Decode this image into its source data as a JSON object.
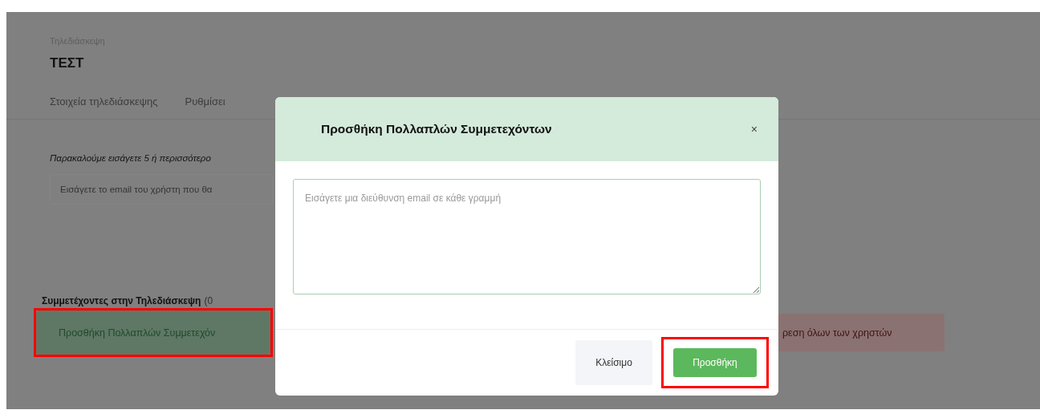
{
  "page": {
    "breadcrumb": "Τηλεδιάσκεψη",
    "title": "ΤΕΣΤ",
    "tabs": [
      "Στοιχεία τηλεδιάσκεψης",
      "Ρυθμίσει"
    ],
    "instruction": "Παρακαλούμε εισάγετε 5 ή περισσότερο",
    "email_field": {
      "placeholder": "Εισάγετε το email του χρήστη που θα"
    },
    "participants_label": "Συμμετέχοντες στην Τηλεδιάσκεψη",
    "participants_count": "(0",
    "add_multiple_button": {
      "label": "Προσθήκη Πολλαπλών Συμμετεχόν",
      "highlighted": true
    },
    "remove_all_button": {
      "label": "ρεση όλων των χρηστών",
      "highlighted": false
    }
  },
  "modal": {
    "title": "Προσθήκη Πολλαπλών Συμμετεχόντων",
    "close": "×",
    "textarea": {
      "placeholder": "Εισάγετε μια διεύθυνση email σε κάθε γραμμή"
    },
    "buttons": [
      {
        "label": "Κλείσιμο",
        "kind": "secondary",
        "highlighted": false
      },
      {
        "label": "Προσθήκη",
        "kind": "primary",
        "highlighted": true
      }
    ]
  }
}
